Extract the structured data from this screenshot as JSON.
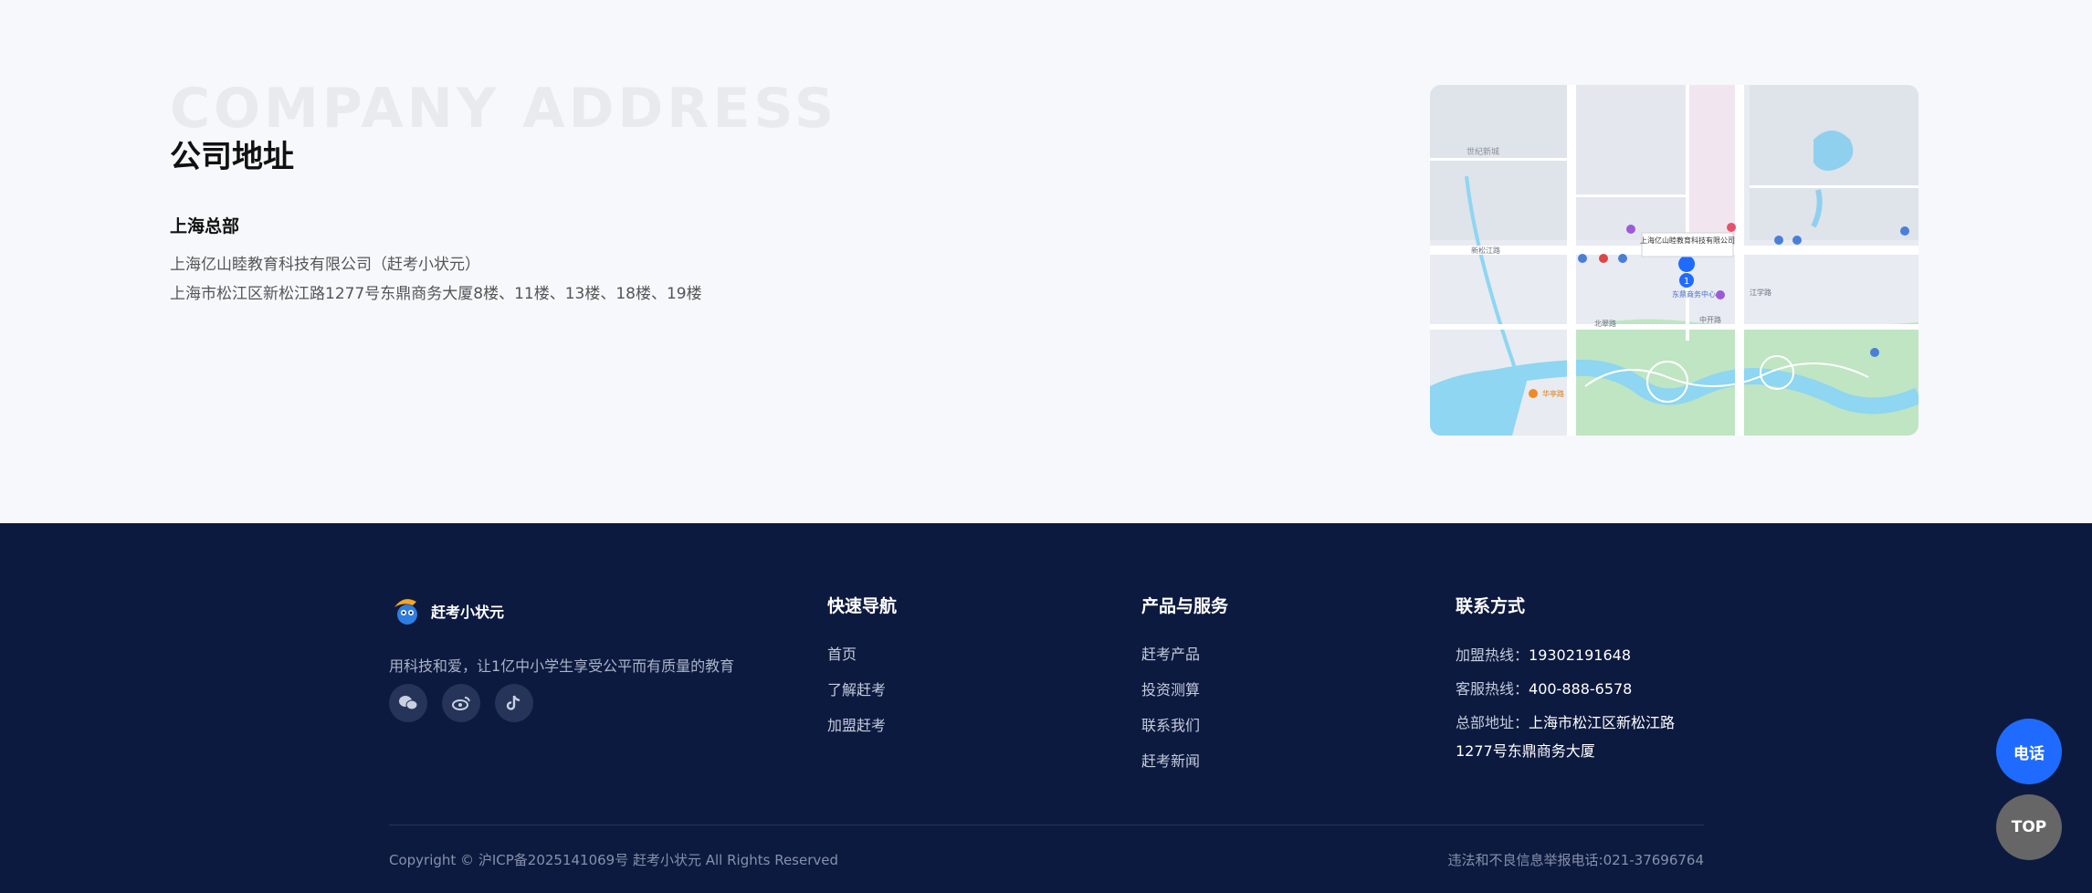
{
  "address_section": {
    "bg_title": "COMPANY ADDRESS",
    "title": "公司地址",
    "hq_label": "上海总部",
    "company_name": "上海亿山睦教育科技有限公司（赶考小状元）",
    "address": "上海市松江区新松江路1277号东鼎商务大厦8楼、11楼、13楼、18楼、19楼"
  },
  "map": {
    "marker_label": "上海亿山睦教育科技有限公司",
    "place_labels": [
      "世纪新城",
      "新松江路",
      "上海亿山睦教育科技有限公司",
      "东鼎商务中心",
      "中开路",
      "北翠路",
      "华亭路",
      "江学路"
    ]
  },
  "footer": {
    "logo_text": "赶考小状元",
    "slogan": "用科技和爱，让1亿中小学生享受公平而有质量的教育",
    "social_icons": [
      "wechat-icon",
      "weibo-icon",
      "douyin-icon"
    ],
    "nav": {
      "title": "快速导航",
      "items": [
        "首页",
        "了解赶考",
        "加盟赶考"
      ]
    },
    "products": {
      "title": "产品与服务",
      "items": [
        "赶考产品",
        "投资测算",
        "联系我们",
        "赶考新闻"
      ]
    },
    "contact": {
      "title": "联系方式",
      "franchise_label": "加盟热线：",
      "franchise_phone": "19302191648",
      "service_label": "客服热线：",
      "service_phone": "400-888-6578",
      "address_label": "总部地址：",
      "address_line1": "上海市松江区新松江路",
      "address_line2": "1277号东鼎商务大厦"
    },
    "copyright": "Copyright © 沪ICP备2025141069号 赶考小状元 All Rights Reserved",
    "report": "违法和不良信息举报电话:021-37696764"
  },
  "fab": {
    "phone_label": "电话",
    "top_label": "TOP"
  },
  "colors": {
    "footer_bg": "#0d1a3f",
    "accent": "#1f6bff"
  }
}
